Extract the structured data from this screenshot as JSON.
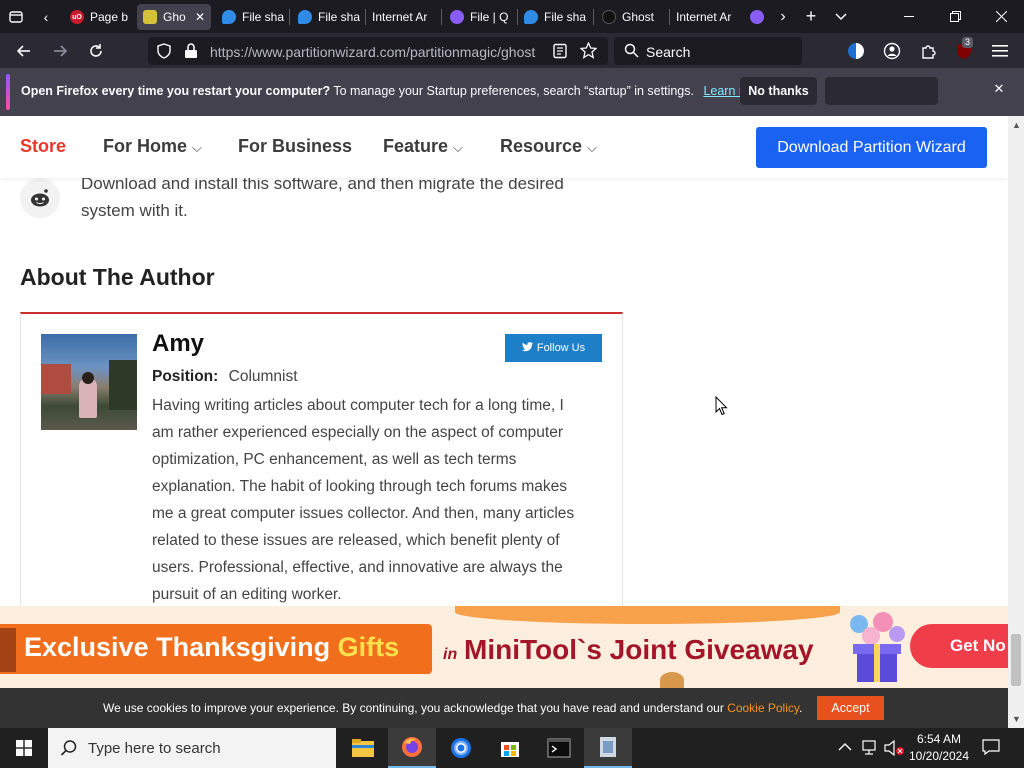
{
  "browser": {
    "tabs": [
      {
        "label": "Page b",
        "favicon_color": "#c71c2b"
      },
      {
        "label": "Gho",
        "favicon_color": "#d4c23a",
        "active": true
      },
      {
        "label": "File sha",
        "favicon_color": "#2f8be6"
      },
      {
        "label": "File sha",
        "favicon_color": "#2f8be6"
      },
      {
        "label": "Internet Ar",
        "favicon_color": ""
      },
      {
        "label": "File | Q",
        "favicon_color": "#8a5cf6"
      },
      {
        "label": "File sha",
        "favicon_color": "#2f8be6"
      },
      {
        "label": "Ghost",
        "favicon_color": "#111111"
      },
      {
        "label": "Internet Ar",
        "favicon_color": ""
      }
    ],
    "url": "https://www.partitionwizard.com/partitionmagic/ghost",
    "search_placeholder": "Search",
    "extension_badge": "3"
  },
  "notification": {
    "bold": "Open Firefox every time you restart your computer?",
    "text": " To manage your Startup preferences, search “startup” in settings.",
    "link": "Learn more",
    "no_thanks": "No thanks",
    "close": "✕"
  },
  "site": {
    "nav": {
      "store": "Store",
      "for_home": "For Home",
      "for_business": "For Business",
      "feature": "Feature",
      "resource": "Resource",
      "download": "Download Partition Wizard"
    },
    "intro_line1": "Download and install this software, and then migrate the desired",
    "intro_line2": "system with it.",
    "about_heading": "About The Author",
    "author": {
      "name": "Amy",
      "position_label": "Position:",
      "position_value": "Columnist",
      "follow": "Follow Us",
      "bio_lines": [
        "Having writing articles about computer tech for a long time, I",
        "am rather experienced especially on the aspect of computer",
        "optimization, PC enhancement, as well as tech terms",
        "explanation. The habit of looking through tech forums makes",
        "me a great computer issues collector. And then, many articles",
        "related to these issues are released, which benefit plenty of",
        "users. Professional, effective, and innovative are always the",
        "pursuit of an editing worker."
      ]
    },
    "banner": {
      "exclusive": "Exclusive Thanksgiving ",
      "gifts": "Gifts",
      "in": "in",
      "giveaway": "MiniTool`s Joint Giveaway",
      "cta": "Get No"
    },
    "cookie": {
      "text": "We use cookies to improve your experience. By continuing, you acknowledge that you have read and understand our ",
      "link": "Cookie Policy",
      "period": ".",
      "accept": "Accept"
    }
  },
  "taskbar": {
    "search_placeholder": "Type here to search",
    "time": "6:54 AM",
    "date": "10/20/2024"
  },
  "colors": {
    "store_red": "#e8372c",
    "download_blue": "#1a62f2",
    "follow_blue": "#1d7fc7",
    "heading_underline": "#c9302c",
    "accept_orange": "#e8501d",
    "cookie_link": "#f7941d",
    "banner_orange": "#f06e1c",
    "banner_red_text": "#a3162a"
  }
}
